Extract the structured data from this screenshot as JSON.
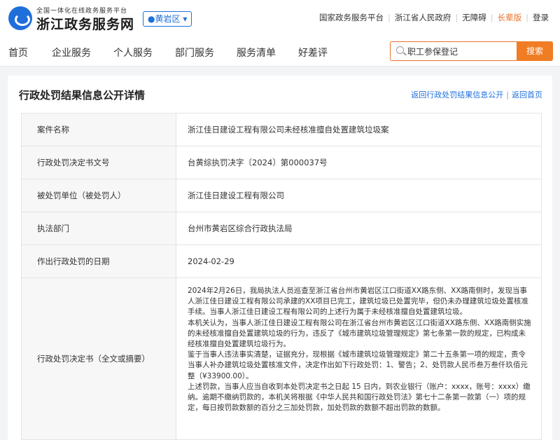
{
  "header": {
    "logo_subtitle": "全国一体化在线政务服务平台",
    "logo_title": "浙江政务服务网",
    "region": "黄岩区",
    "links": [
      "国家政务服务平台",
      "浙江省人民政府",
      "无障碍",
      "长辈版",
      "登录"
    ]
  },
  "nav": {
    "items": [
      "首页",
      "企业服务",
      "个人服务",
      "部门服务",
      "服务清单",
      "好差评"
    ]
  },
  "search": {
    "value": "职工参保登记",
    "button": "搜索"
  },
  "detail": {
    "title": "行政处罚结果信息公开详情",
    "link_back_list": "返回行政处罚结果信息公开",
    "link_sep": "|",
    "link_home": "返回首页",
    "rows": [
      {
        "label": "案件名称",
        "value": "浙江佳日建设工程有限公司未经核准擅自处置建筑垃圾案"
      },
      {
        "label": "行政处罚决定书文号",
        "value": "台黄综执罚决字〔2024〕第000037号"
      },
      {
        "label": "被处罚单位（被处罚人）",
        "value": "浙江佳日建设工程有限公司"
      },
      {
        "label": "执法部门",
        "value": "台州市黄岩区综合行政执法局"
      },
      {
        "label": "作出行政处罚的日期",
        "value": "2024-02-29"
      }
    ],
    "full_text_label": "行政处罚决定书（全文或摘要）",
    "full_text": [
      "2024年2月26日，我局执法人员巡查至浙江省台州市黄岩区江口街道XX路东侧、XX路南侧时，发现当事人浙江佳日建设工程有限公司承建的XX项目已完工，建筑垃圾已处置完毕，但仍未办理建筑垃圾处置核准手续。当事人浙江佳日建设工程有限公司的上述行为属于未经核准擅自处置建筑垃圾。",
      "本机关认为，当事人浙江佳日建设工程有限公司在浙江省台州市黄岩区江口街道XX路东侧、XX路南侧实施的未经核准擅自处置建筑垃圾的行为，违反了《城市建筑垃圾管理规定》第七条第一款的规定，已构成未经核准擅自处置建筑垃圾行为。",
      "鉴于当事人违法事实清楚，证据充分，现根据《城市建筑垃圾管理规定》第二十五条第一项的规定，责令当事人补办建筑垃圾处置核准文件，决定作出如下行政处罚：1、警告；2、处罚款人民币叁万叁仟玖佰元整（¥33900.00）。",
      "上述罚款，当事人应当自收到本处罚决定书之日起 15 日内，到农业银行（账户：xxxx，账号：xxxx）缴纳。逾期不缴纳罚款的，本机关将根据《中华人民共和国行政处罚法》第七十二条第一款第（一）项的规定，每日按罚款数额的百分之三加处罚款，加处罚款的数额不超出罚款的数额。"
    ]
  }
}
